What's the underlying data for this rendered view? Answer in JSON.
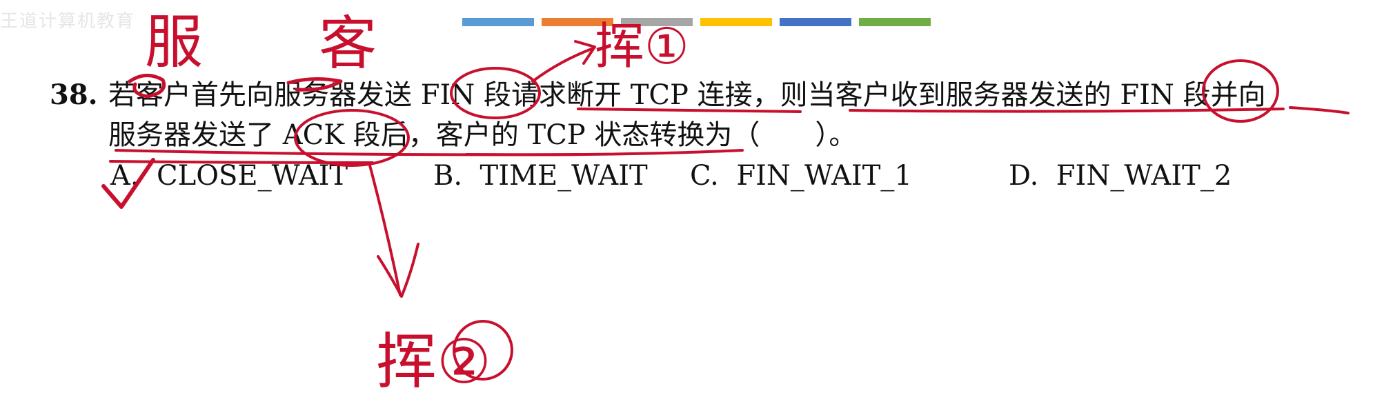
{
  "watermark": "王道计算机教育",
  "top_bars": {
    "colors": [
      "#5b9bd5",
      "#ed7d31",
      "#a5a5a5",
      "#ffc000",
      "#4472c4",
      "#70ad47"
    ]
  },
  "question": {
    "number": "38.",
    "line1": "若客户首先向服务器发送 FIN 段请求断开 TCP 连接，则当客户收到服务器发送的 FIN 段并向",
    "line2": "服务器发送了 ACK 段后，客户的 TCP 状态转换为（　　）。"
  },
  "options": [
    {
      "label": "A.",
      "text": "CLOSE_WAIT"
    },
    {
      "label": "B.",
      "text": "TIME_WAIT"
    },
    {
      "label": "C.",
      "text": "FIN_WAIT_1"
    },
    {
      "label": "D.",
      "text": "FIN_WAIT_2"
    }
  ],
  "annotations": {
    "server": "服",
    "client": "客",
    "wave1": "挥①",
    "wave2": "挥②",
    "ink_color": "#c8102e"
  }
}
